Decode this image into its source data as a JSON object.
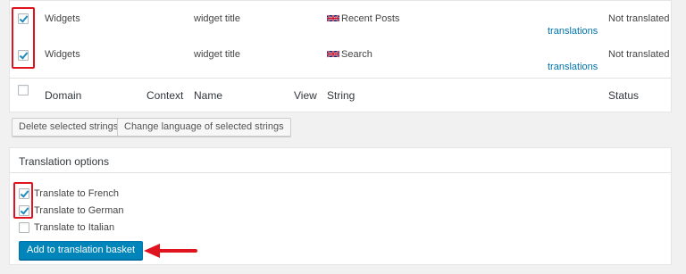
{
  "table": {
    "rows": [
      {
        "checked": true,
        "domain": "Widgets",
        "name": "widget title",
        "flag": "uk-flag-icon",
        "string": "Recent Posts",
        "link": "translations",
        "status": "Not translated"
      },
      {
        "checked": true,
        "domain": "Widgets",
        "name": "widget title",
        "flag": "uk-flag-icon",
        "string": "Search",
        "link": "translations",
        "status": "Not translated"
      }
    ],
    "headers": {
      "domain": "Domain",
      "context": "Context",
      "name": "Name",
      "view": "View",
      "string": "String",
      "status": "Status"
    }
  },
  "actions": {
    "delete_label": "Delete selected strings",
    "change_language_label": "Change language of selected strings"
  },
  "translation_options": {
    "title": "Translation options",
    "languages": [
      {
        "label": "Translate to French",
        "checked": true
      },
      {
        "label": "Translate to German",
        "checked": true
      },
      {
        "label": "Translate to Italian",
        "checked": false
      }
    ],
    "button_label": "Add to translation basket"
  },
  "colors": {
    "highlight": "#e0141e",
    "primary": "#0085ba",
    "link": "#0073aa"
  }
}
